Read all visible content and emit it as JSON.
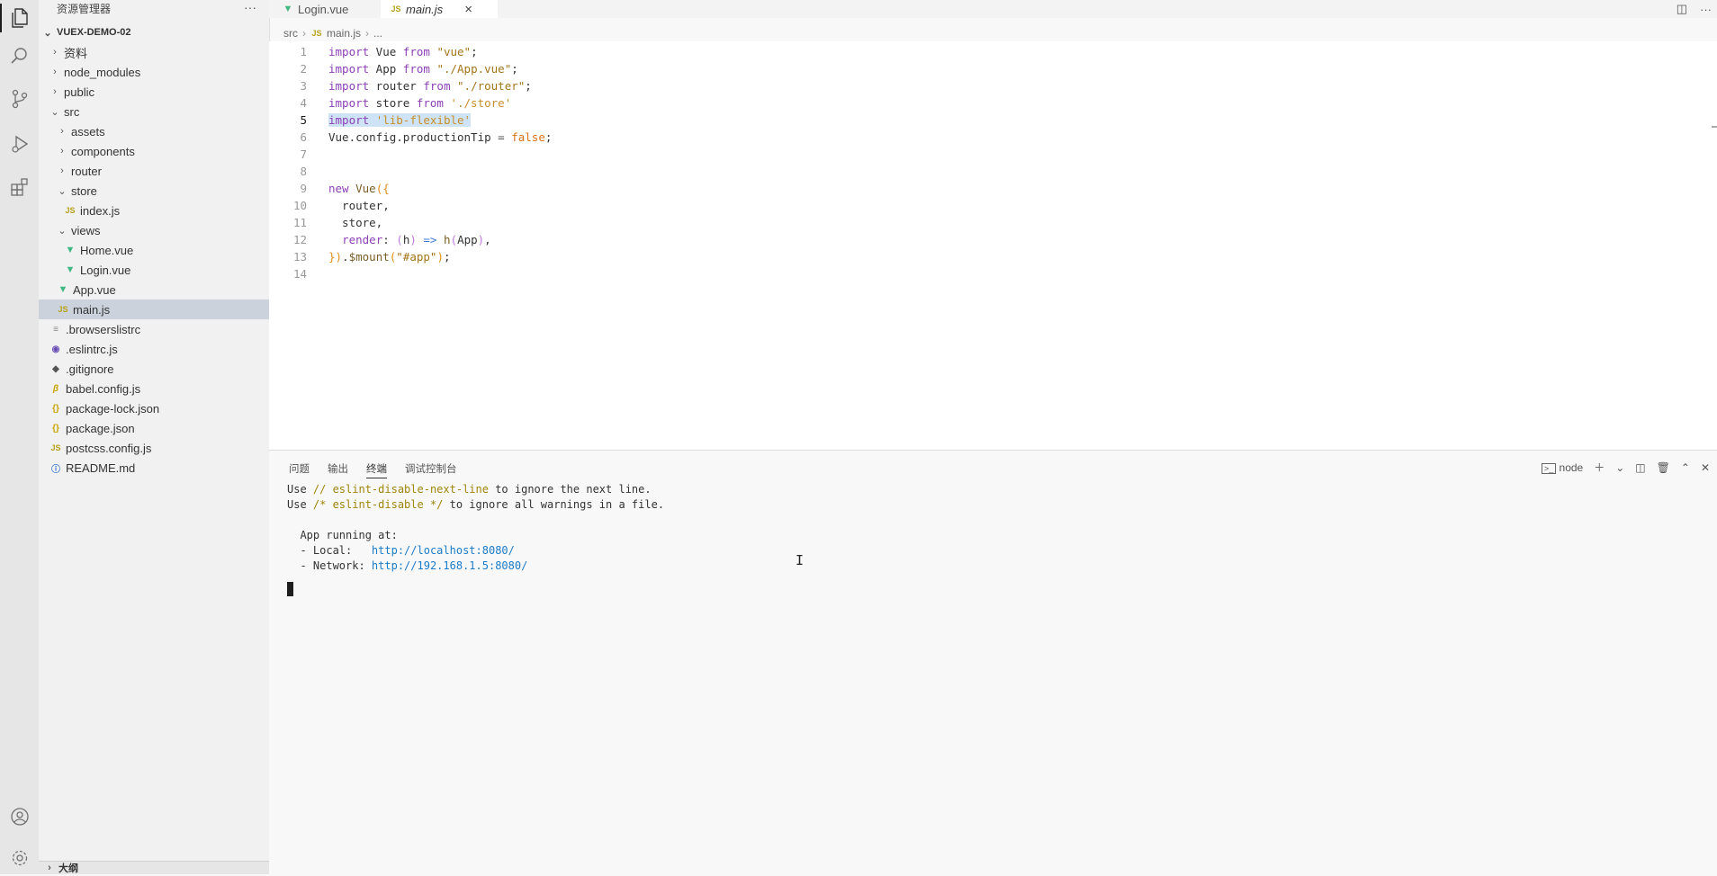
{
  "activity_bar": {
    "top_icons": [
      "files-icon",
      "search-icon",
      "source-control-icon",
      "run-debug-icon",
      "extensions-icon"
    ],
    "bottom_icons": [
      "account-icon",
      "settings-gear-icon"
    ]
  },
  "sidebar": {
    "title": "资源管理器",
    "more": "···",
    "root": "VUEX-DEMO-02",
    "items": [
      {
        "label": "资料",
        "type": "folder",
        "depth": 1,
        "expanded": false
      },
      {
        "label": "node_modules",
        "type": "folder",
        "depth": 1,
        "expanded": false
      },
      {
        "label": "public",
        "type": "folder",
        "depth": 1,
        "expanded": false
      },
      {
        "label": "src",
        "type": "folder",
        "depth": 1,
        "expanded": true
      },
      {
        "label": "assets",
        "type": "folder",
        "depth": 2,
        "expanded": false
      },
      {
        "label": "components",
        "type": "folder",
        "depth": 2,
        "expanded": false
      },
      {
        "label": "router",
        "type": "folder",
        "depth": 2,
        "expanded": false
      },
      {
        "label": "store",
        "type": "folder",
        "depth": 2,
        "expanded": true
      },
      {
        "label": "index.js",
        "type": "js",
        "depth": 3
      },
      {
        "label": "views",
        "type": "folder",
        "depth": 2,
        "expanded": true
      },
      {
        "label": "Home.vue",
        "type": "vue",
        "depth": 3
      },
      {
        "label": "Login.vue",
        "type": "vue",
        "depth": 3
      },
      {
        "label": "App.vue",
        "type": "vue",
        "depth": 2
      },
      {
        "label": "main.js",
        "type": "js",
        "depth": 2,
        "selected": true
      },
      {
        "label": ".browserslistrc",
        "type": "list",
        "depth": 1
      },
      {
        "label": ".eslintrc.js",
        "type": "eslint",
        "depth": 1
      },
      {
        "label": ".gitignore",
        "type": "git",
        "depth": 1
      },
      {
        "label": "babel.config.js",
        "type": "babel",
        "depth": 1
      },
      {
        "label": "package-lock.json",
        "type": "json",
        "depth": 1
      },
      {
        "label": "package.json",
        "type": "json",
        "depth": 1
      },
      {
        "label": "postcss.config.js",
        "type": "js",
        "depth": 1
      },
      {
        "label": "README.md",
        "type": "info",
        "depth": 1
      }
    ],
    "outline_label": "大纲"
  },
  "tabs": [
    {
      "label": "Login.vue",
      "icon": "vue",
      "active": false
    },
    {
      "label": "main.js",
      "icon": "js",
      "active": true,
      "close": "×"
    }
  ],
  "breadcrumb": {
    "folder": "src",
    "file": "main.js",
    "more": "..."
  },
  "editor": {
    "current_line": 5,
    "lines": [
      [
        [
          "kw",
          "import"
        ],
        [
          "plain",
          " Vue "
        ],
        [
          "kw",
          "from"
        ],
        [
          "plain",
          " "
        ],
        [
          "str",
          "\"vue\""
        ],
        [
          "plain",
          ";"
        ]
      ],
      [
        [
          "kw",
          "import"
        ],
        [
          "plain",
          " App "
        ],
        [
          "kw",
          "from"
        ],
        [
          "plain",
          " "
        ],
        [
          "str",
          "\"./App.vue\""
        ],
        [
          "plain",
          ";"
        ]
      ],
      [
        [
          "kw",
          "import"
        ],
        [
          "plain",
          " router "
        ],
        [
          "kw",
          "from"
        ],
        [
          "plain",
          " "
        ],
        [
          "str",
          "\"./router\""
        ],
        [
          "plain",
          ";"
        ]
      ],
      [
        [
          "kw",
          "import"
        ],
        [
          "plain",
          " store "
        ],
        [
          "kw",
          "from"
        ],
        [
          "plain",
          " "
        ],
        [
          "str2",
          "'./store'"
        ]
      ],
      [
        [
          "kw",
          "import",
          "hl"
        ],
        [
          "plain",
          " ",
          "hl"
        ],
        [
          "str2",
          "'lib-flexible'",
          "hl"
        ]
      ],
      [
        [
          "plain",
          "Vue.config.productionTip "
        ],
        [
          "op",
          "="
        ],
        [
          "plain",
          " "
        ],
        [
          "bool",
          "false"
        ],
        [
          "plain",
          ";"
        ]
      ],
      [],
      [],
      [
        [
          "kw",
          "new"
        ],
        [
          "plain",
          " "
        ],
        [
          "fn",
          "Vue"
        ],
        [
          "paren",
          "({"
        ]
      ],
      [
        [
          "plain",
          "  router,"
        ]
      ],
      [
        [
          "plain",
          "  store,"
        ]
      ],
      [
        [
          "plain",
          "  "
        ],
        [
          "kw",
          "render"
        ],
        [
          "plain",
          ": "
        ],
        [
          "paren2",
          "("
        ],
        [
          "plain",
          "h"
        ],
        [
          "paren2",
          ")"
        ],
        [
          "plain",
          " "
        ],
        [
          "arrow",
          "=>"
        ],
        [
          "plain",
          " "
        ],
        [
          "fn",
          "h"
        ],
        [
          "paren2",
          "("
        ],
        [
          "plain",
          "App"
        ],
        [
          "paren2",
          ")"
        ],
        [
          "plain",
          ","
        ]
      ],
      [
        [
          "paren",
          "})"
        ],
        [
          "plain",
          "."
        ],
        [
          "fn",
          "$mount"
        ],
        [
          "paren",
          "("
        ],
        [
          "str",
          "\"#app\""
        ],
        [
          "paren",
          ")"
        ],
        [
          "plain",
          ";"
        ]
      ],
      []
    ]
  },
  "panel": {
    "tabs": [
      "问题",
      "输出",
      "终端",
      "调试控制台"
    ],
    "active_tab": 2,
    "shell": "node",
    "terminal": [
      [
        [
          "p",
          "Use "
        ],
        [
          "y",
          "// eslint-disable-next-line"
        ],
        [
          "p",
          " to ignore the next line."
        ]
      ],
      [
        [
          "p",
          "Use "
        ],
        [
          "y",
          "/* eslint-disable */"
        ],
        [
          "p",
          " to ignore all warnings in a file."
        ]
      ],
      [],
      [
        [
          "p",
          "  App running at:"
        ]
      ],
      [
        [
          "p",
          "  - Local:   "
        ],
        [
          "link",
          "http://localhost:8080/"
        ]
      ],
      [
        [
          "p",
          "  - Network: "
        ],
        [
          "link",
          "http://192.168.1.5:8080/"
        ]
      ]
    ]
  }
}
